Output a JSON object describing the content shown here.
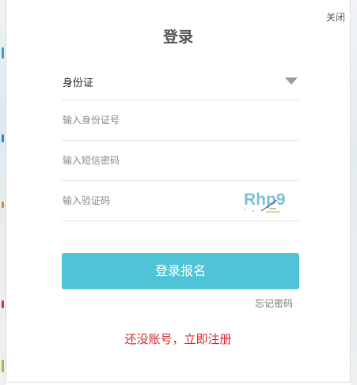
{
  "dialog": {
    "close_label": "关闭",
    "title": "登录"
  },
  "form": {
    "id_type_selected": "身份证",
    "id_number_placeholder": "输入身份证号",
    "sms_code_placeholder": "输入短信密码",
    "verify_code_placeholder": "输入验证码",
    "captcha_text": "Rhp9"
  },
  "actions": {
    "login_label": "登录报名",
    "forgot_label": "忘记密码",
    "register_label": "还没账号，立即注册"
  },
  "colors": {
    "accent": "#4fc4d7",
    "register": "#d1282a",
    "captcha": "#7fbfd0"
  }
}
